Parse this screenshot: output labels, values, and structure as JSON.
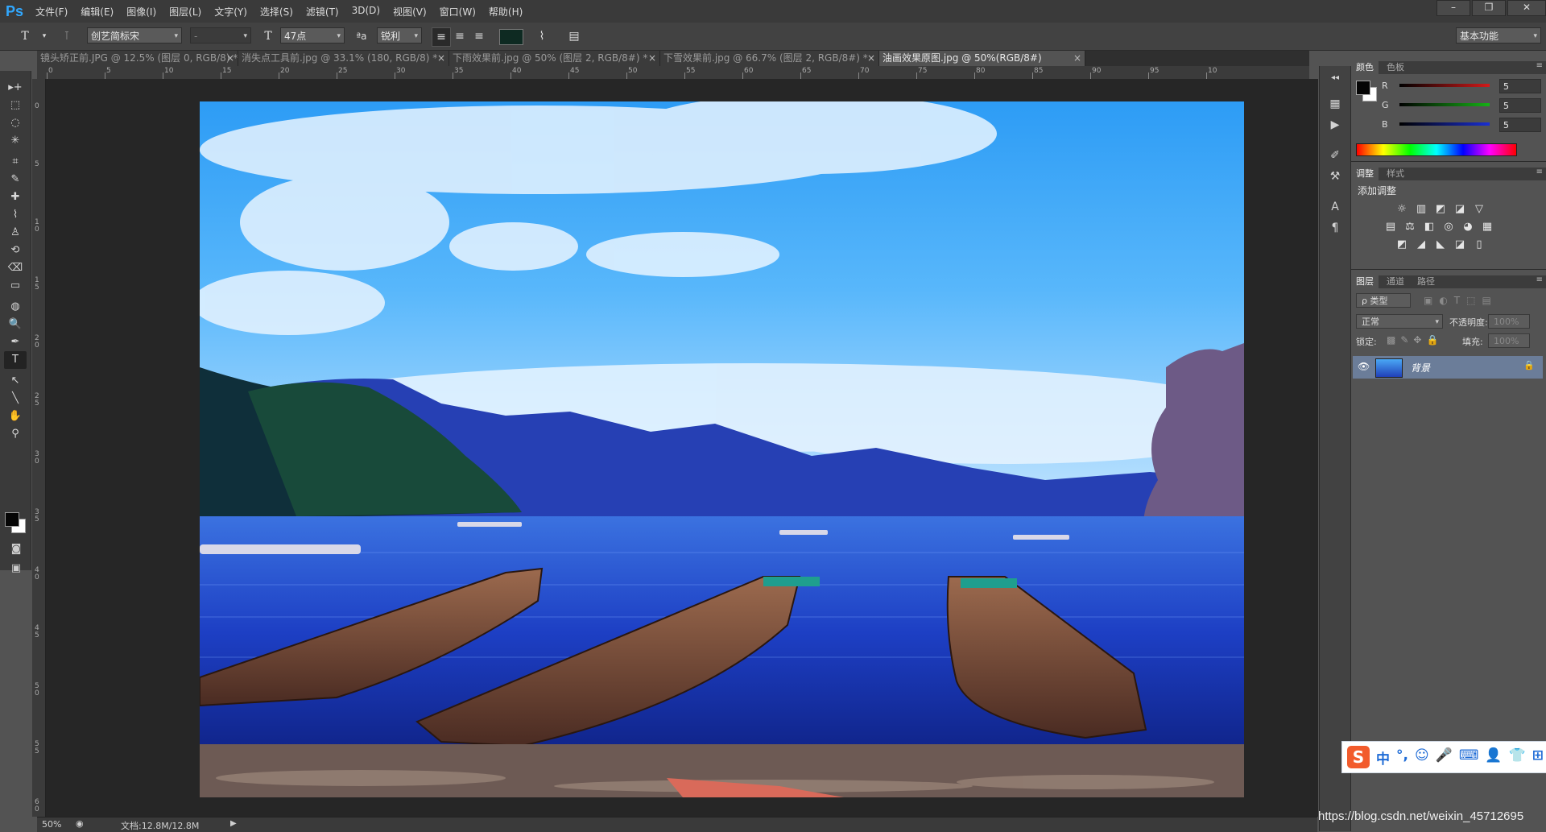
{
  "app": {
    "logo": "Ps"
  },
  "menu": [
    "文件(F)",
    "编辑(E)",
    "图像(I)",
    "图层(L)",
    "文字(Y)",
    "选择(S)",
    "滤镜(T)",
    "3D(D)",
    "视图(V)",
    "窗口(W)",
    "帮助(H)"
  ],
  "window_controls": {
    "minimize": "–",
    "restore": "❐",
    "close": "✕"
  },
  "options_bar": {
    "tool_icon": "T",
    "font_family": "创艺简标宋",
    "font_style": "-",
    "size_icon": "T",
    "font_size": "47点",
    "aa_icon": "ªa",
    "antialias": "锐利",
    "text_color": "#0e2a22",
    "workspace": "基本功能"
  },
  "tabs": [
    {
      "label": "镜头矫正前.JPG @ 12.5% (图层 0, RGB/8) *"
    },
    {
      "label": "消失点工具前.jpg @ 33.1% (180, RGB/8) *"
    },
    {
      "label": "下雨效果前.jpg @ 50% (图层 2, RGB/8#) *"
    },
    {
      "label": "下雪效果前.jpg @ 66.7% (图层 2, RGB/8#) *"
    },
    {
      "label": "油画效果原图.jpg @ 50%(RGB/8#)"
    }
  ],
  "ruler": {
    "h_labels": [
      "0",
      "5",
      "10",
      "15",
      "20",
      "25",
      "30",
      "35",
      "40",
      "45",
      "50",
      "55",
      "60",
      "65",
      "70",
      "75",
      "80",
      "85",
      "90",
      "95",
      "10"
    ],
    "v_labels": [
      "0",
      "5",
      "1 0",
      "1 5",
      "2 0",
      "2 5",
      "3 0",
      "3 5",
      "4 0",
      "4 5",
      "5 0",
      "5 5",
      "6 0"
    ]
  },
  "tools": [
    "▸+",
    "⬚",
    "◌",
    "✳",
    "⌗",
    "✎",
    "✚",
    "⌇",
    "♙",
    "⟲",
    "⌫",
    "▭",
    "◍",
    "🔍",
    "✒",
    "T",
    "↖",
    "╲",
    "✋",
    "⚲"
  ],
  "status": {
    "zoom": "50%",
    "doc_size": "文档:12.8M/12.8M"
  },
  "color_panel": {
    "tabs": [
      "颜色",
      "色板"
    ],
    "foreground": "#050505",
    "background": "#ffffff",
    "channels": [
      {
        "label": "R",
        "value": "5",
        "color": "#d21a1a"
      },
      {
        "label": "G",
        "value": "5",
        "color": "#16b016"
      },
      {
        "label": "B",
        "value": "5",
        "color": "#1a2fd2"
      }
    ]
  },
  "adjustments_panel": {
    "tabs": [
      "调整",
      "样式"
    ],
    "title": "添加调整",
    "row1": [
      "☼",
      "▥",
      "◩",
      "◪",
      "▽"
    ],
    "row2": [
      "▤",
      "⚖",
      "◧",
      "◎",
      "◕",
      "▦"
    ],
    "row3": [
      "◩",
      "◢",
      "◣",
      "◪",
      "▯"
    ]
  },
  "layers_panel": {
    "tabs": [
      "图层",
      "通道",
      "路径"
    ],
    "filter": "ρ 类型",
    "blend_mode": "正常",
    "opacity_label": "不透明度:",
    "opacity": "100%",
    "lock_label": "锁定:",
    "fill_label": "填充:",
    "fill": "100%",
    "layers": [
      {
        "name": "背景",
        "visible": true,
        "locked": true
      }
    ]
  },
  "ime": {
    "logo": "S",
    "items": [
      "中",
      "°,",
      "☺",
      "🎤",
      "⌨",
      "👤",
      "👕",
      "⊞"
    ]
  },
  "watermark": "https://blog.csdn.net/weixin_45712695"
}
